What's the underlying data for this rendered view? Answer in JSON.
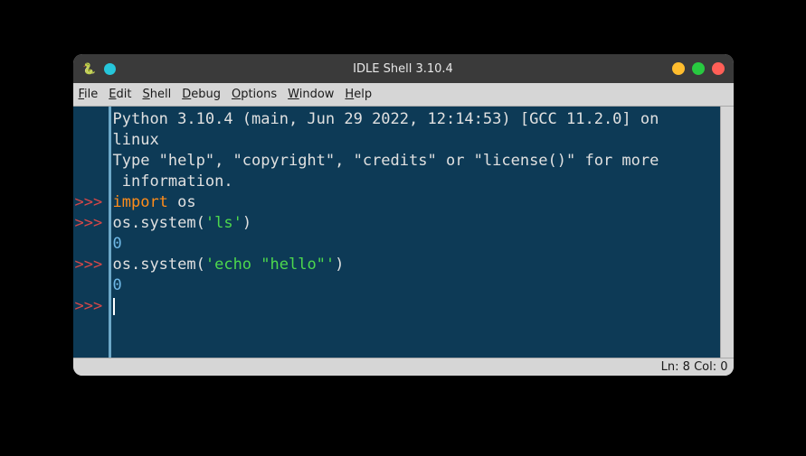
{
  "titlebar": {
    "title": "IDLE Shell 3.10.4"
  },
  "menu": {
    "file": "File",
    "edit": "Edit",
    "shell": "Shell",
    "debug": "Debug",
    "options": "Options",
    "window": "Window",
    "help": "Help"
  },
  "prompts": {
    "p1": ">>>",
    "p2": ">>>",
    "p3": ">>>",
    "p4": ">>>"
  },
  "lines": {
    "banner1a": "Python 3.10.4 (main, Jun 29 2022, 12:14:53) [GCC 11.2.0] on ",
    "banner1b": "linux",
    "banner2a": "Type \"help\", \"copyright\", \"credits\" or \"license()\" for more",
    "banner2b": " information.",
    "import_kw": "import",
    "import_mod": " os",
    "call1_pre": "os.system(",
    "call1_str": "'ls'",
    "call1_post": ")",
    "out1": "0",
    "call2_pre": "os.system(",
    "call2_str": "'echo \"hello\"'",
    "call2_post": ")",
    "out2": "0"
  },
  "status": {
    "text": "Ln: 8  Col: 0"
  }
}
